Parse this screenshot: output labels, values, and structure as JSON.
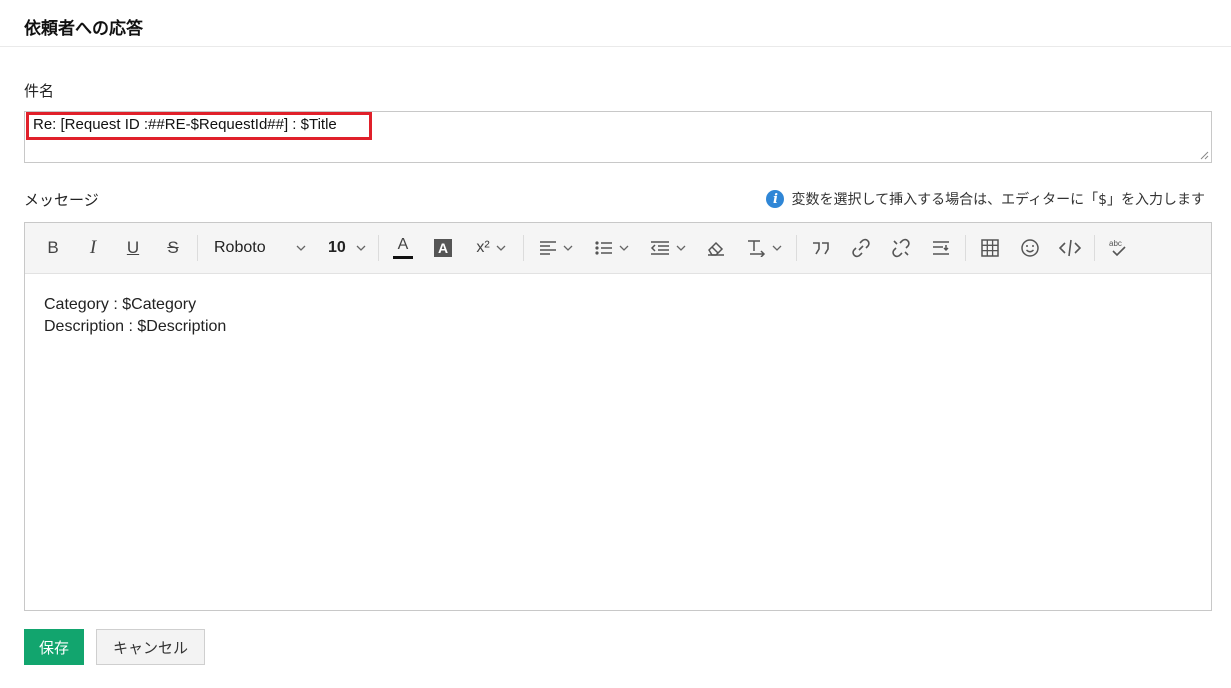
{
  "page": {
    "title": "依頼者への応答"
  },
  "subject": {
    "label": "件名",
    "value": "Re: [Request ID :##RE-$RequestId##] : $Title"
  },
  "message": {
    "label": "メッセージ",
    "hint": "変数を選択して挿入する場合は、エディターに「$」を入力します",
    "hint_icon": "info-icon",
    "body_lines": [
      "Category : $Category",
      "Description : $Description"
    ]
  },
  "toolbar": {
    "bold": "B",
    "italic": "I",
    "underline": "U",
    "strikethrough": "S",
    "font_name": "Roboto",
    "font_size": "10",
    "text_color": "A",
    "bg_color": "A",
    "superscript": "x²"
  },
  "actions": {
    "save_label": "保存",
    "cancel_label": "キャンセル"
  },
  "colors": {
    "accent": "#12a56e",
    "highlight": "#e0202a",
    "info": "#2f86d6"
  }
}
